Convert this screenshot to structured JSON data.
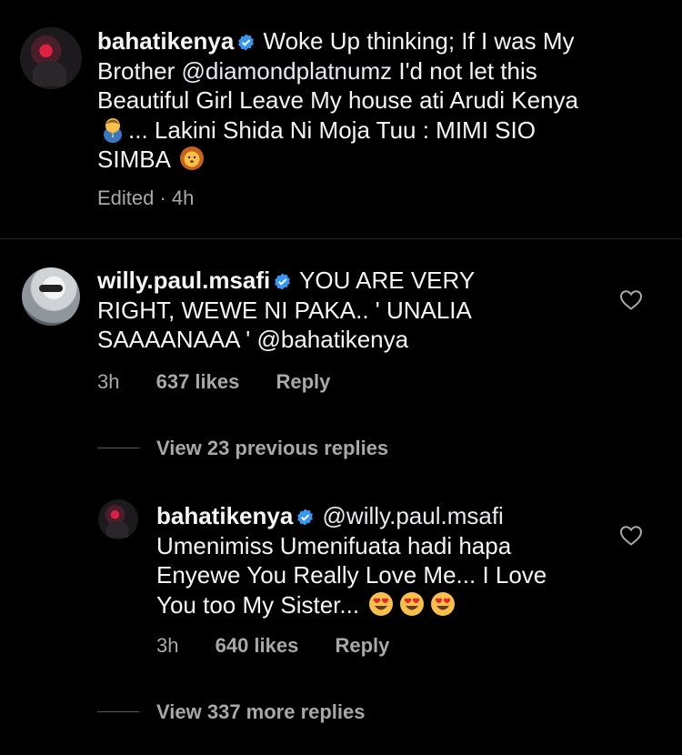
{
  "caption": {
    "username": "bahatikenya",
    "text_line1": "Woke Up thinking; If I was My",
    "text_line2_a": "Brother ",
    "mention": "@diamondplatnumz",
    "text_line2_b": " I'd not let this",
    "text_line3": "Beautiful Girl Leave My house ati Arudi Kenya",
    "text_line4": "... Lakini Shida Ni Moja Tuu : MIMI SIO",
    "text_line5": "SIMBA",
    "meta": "Edited · 4h"
  },
  "comment": {
    "username": "willy.paul.msafi",
    "text_line1": "YOU ARE VERY",
    "text_line2": "RIGHT, WEWE NI PAKA.. ' UNALIA",
    "text_line3": "SAAAANAAA ' @bahatikenya",
    "time": "3h",
    "likes": "637 likes",
    "reply": "Reply"
  },
  "view_previous": "View 23 previous replies",
  "reply": {
    "username": "bahatikenya",
    "mention": "@willy.paul.msafi",
    "text_line2": "Umenimiss Umenifuata hadi hapa",
    "text_line3": "Enyewe You Really Love Me... I Love",
    "text_line4": "You too My Sister...",
    "time": "3h",
    "likes": "640 likes",
    "reply": "Reply"
  },
  "view_more": "View 337 more replies",
  "icons": {
    "verified": "verified-badge-icon",
    "heart": "heart-outline-icon",
    "pray": "praying-person-emoji",
    "lion": "lion-emoji",
    "hearteyes": "heart-eyes-emoji"
  },
  "colors": {
    "background": "#000000",
    "text": "#f5f5f5",
    "secondary": "#a8a8a8",
    "verified": "#3897f0"
  }
}
